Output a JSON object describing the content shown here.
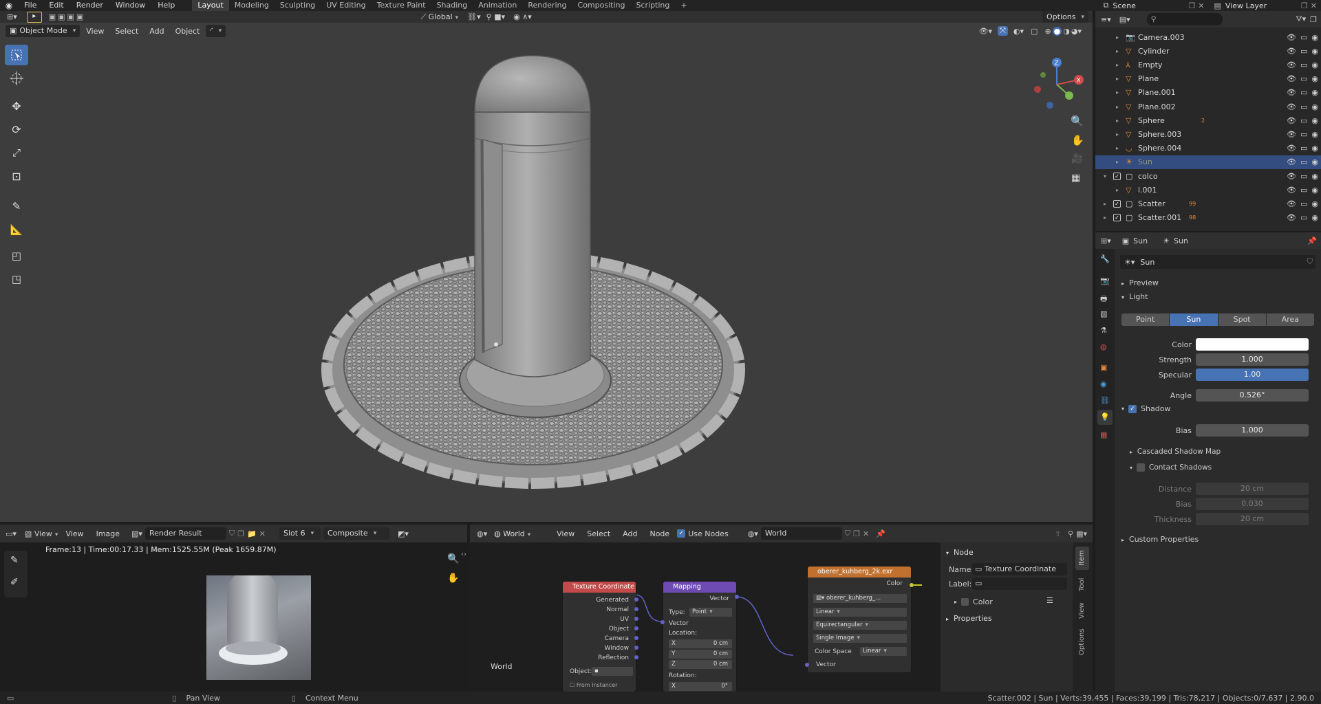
{
  "menu": {
    "items": [
      "File",
      "Edit",
      "Render",
      "Window",
      "Help"
    ],
    "workspaces": [
      "Layout",
      "Modeling",
      "Sculpting",
      "UV Editing",
      "Texture Paint",
      "Shading",
      "Animation",
      "Rendering",
      "Compositing",
      "Scripting"
    ],
    "active_workspace": "Layout",
    "add_tab": "+",
    "scene": "Scene",
    "view_layer": "View Layer"
  },
  "viewport": {
    "mode": "Object Mode",
    "menus": [
      "View",
      "Select",
      "Add",
      "Object"
    ],
    "orientation": "Global",
    "options": "Options",
    "gizmo": {
      "x": "X",
      "y": "Y",
      "z": "Z"
    },
    "tools": [
      "select-box-icon",
      "cursor-icon",
      "move-icon",
      "rotate-icon",
      "scale-icon",
      "transform-icon",
      "annotate-icon",
      "measure-icon",
      "add-cube-icon",
      "scale-cage-icon"
    ]
  },
  "outliner": {
    "search_placeholder": "",
    "rows": [
      {
        "name": "Camera.003",
        "icon": "camera",
        "indent": 1,
        "selected": false
      },
      {
        "name": "Cylinder",
        "icon": "mesh",
        "indent": 1,
        "selected": false
      },
      {
        "name": "Empty",
        "icon": "empty",
        "indent": 1,
        "selected": false
      },
      {
        "name": "Plane",
        "icon": "mesh",
        "indent": 1,
        "selected": false
      },
      {
        "name": "Plane.001",
        "icon": "mesh",
        "indent": 1,
        "selected": false
      },
      {
        "name": "Plane.002",
        "icon": "mesh",
        "indent": 1,
        "selected": false
      },
      {
        "name": "Sphere",
        "icon": "mesh",
        "indent": 1,
        "selected": false,
        "badge": "2"
      },
      {
        "name": "Sphere.003",
        "icon": "mesh",
        "indent": 1,
        "selected": false
      },
      {
        "name": "Sphere.004",
        "icon": "curve",
        "indent": 1,
        "selected": false
      },
      {
        "name": "Sun",
        "icon": "light",
        "indent": 1,
        "selected": true
      },
      {
        "name": "colco",
        "icon": "collection",
        "indent": 0,
        "selected": false
      },
      {
        "name": "l.001",
        "icon": "mesh",
        "indent": 1,
        "selected": false
      },
      {
        "name": "Scatter",
        "icon": "collection",
        "indent": 0,
        "selected": false,
        "badge": "99"
      },
      {
        "name": "Scatter.001",
        "icon": "collection",
        "indent": 0,
        "selected": false,
        "badge": "98"
      }
    ]
  },
  "properties": {
    "breadcrumb_object": "Sun",
    "breadcrumb_data": "Sun",
    "datablock": "Sun",
    "preview": "Preview",
    "light_panel": "Light",
    "light_types": [
      "Point",
      "Sun",
      "Spot",
      "Area"
    ],
    "active_light_type": "Sun",
    "color_label": "Color",
    "color_value": "#ffffff",
    "strength_label": "Strength",
    "strength": "1.000",
    "specular_label": "Specular",
    "specular": "1.00",
    "angle_label": "Angle",
    "angle": "0.526°",
    "shadow_panel": "Shadow",
    "bias_label": "Bias",
    "bias": "1.000",
    "cascaded": "Cascaded Shadow Map",
    "contact": "Contact Shadows",
    "distance_label": "Distance",
    "distance": "20 cm",
    "cbias_label": "Bias",
    "cbias": "0.030",
    "thickness_label": "Thickness",
    "thickness": "20 cm",
    "custom": "Custom Properties"
  },
  "image_editor": {
    "view_dd": "View",
    "menus": [
      "View",
      "Image"
    ],
    "image_name": "Render Result",
    "slot": "Slot 6",
    "pass": "Composite",
    "info": "Frame:13 | Time:00:17.33 | Mem:1525.55M (Peak 1659.87M)"
  },
  "node_editor": {
    "type": "World",
    "menus": [
      "View",
      "Select",
      "Add",
      "Node"
    ],
    "use_nodes": "Use Nodes",
    "world_name": "World",
    "corner_label": "World",
    "tex_coord": {
      "title": "Texture Coordinate",
      "outputs": [
        "Generated",
        "Normal",
        "UV",
        "Object",
        "Camera",
        "Window",
        "Reflection"
      ],
      "object_label": "Object:",
      "from_instancer": "From Instancer"
    },
    "mapping": {
      "title": "Mapping",
      "output": "Vector",
      "type_label": "Type:",
      "type": "Point",
      "input": "Vector",
      "location_label": "Location:",
      "x_label": "X",
      "x": "0 cm",
      "y_label": "Y",
      "y": "0 cm",
      "z_label": "Z",
      "z": "0 cm",
      "rotation_label": "Rotation:",
      "rx_label": "X",
      "rx": "0°"
    },
    "env": {
      "title": "oberer_kuhberg_2k.exr",
      "output": "Color",
      "image": "oberer_kuhberg_...",
      "interp": "Linear",
      "projection": "Equirectangular",
      "source": "Single Image",
      "cs_label": "Color Space",
      "cs": "Linear",
      "input": "Vector"
    },
    "sidebar": {
      "node_panel": "Node",
      "name_label": "Name:",
      "name": "Texture Coordinate",
      "label_label": "Label:",
      "color": "Color",
      "properties": "Properties",
      "tabs": [
        "Item",
        "Tool",
        "View",
        "Options"
      ]
    }
  },
  "statusbar": {
    "pan": "Pan View",
    "context": "Context Menu",
    "stats": "Scatter.002 | Sun | Verts:39,455 | Faces:39,199 | Tris:78,217 | Objects:0/7,637 | 2.90.0"
  }
}
